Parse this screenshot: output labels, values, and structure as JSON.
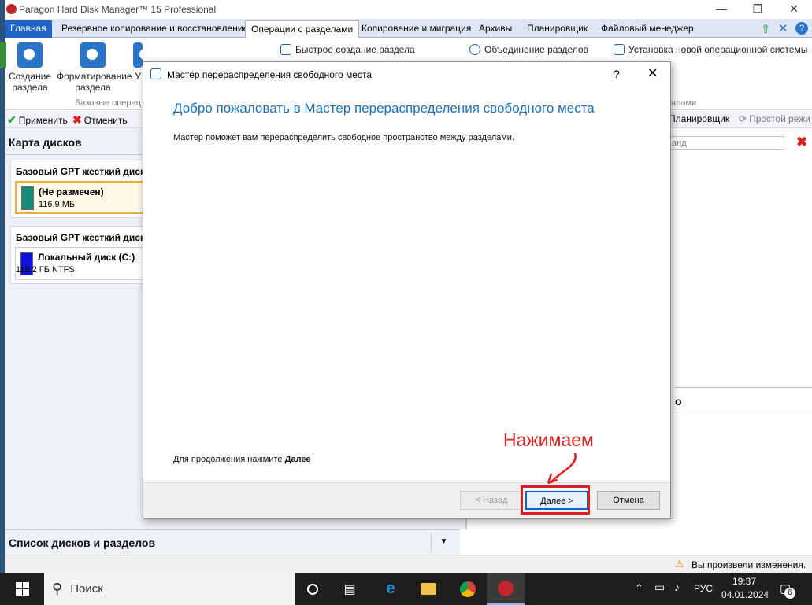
{
  "app": {
    "title": "Paragon Hard Disk Manager™ 15 Professional"
  },
  "menu": {
    "tabs": [
      "Главная",
      "Резервное копирование и восстановление",
      "Операции с разделами",
      "Копирование и миграция",
      "Архивы",
      "Планировщик",
      "Файловый менеджер"
    ]
  },
  "ribbon": {
    "big": [
      "Создание раздела",
      "Форматирование раздела",
      "У",
      "",
      ""
    ],
    "group_basic": "Базовые операц",
    "group_right": "ялами",
    "quick_create": "Быстрое создание раздела",
    "merge": "Объединение разделов",
    "install_os": "Установка новой операционной системы"
  },
  "toolbar": {
    "apply": "Применить",
    "cancel": "Отменить",
    "scheduler": "Планировщик",
    "preview": "Простой режи",
    "search_placeholder": "анд"
  },
  "left": {
    "disk_map": "Карта дисков",
    "disk1": {
      "title": "Базовый GPT жесткий диск",
      "part_name": "(Не размечен)",
      "part_size": "116.9 МБ"
    },
    "disk2": {
      "title": "Базовый GPT жесткий диск",
      "part_name": "Локальный диск (C:)",
      "part_size": "119.2 ГБ NTFS"
    },
    "list_title": "Список дисков и разделов"
  },
  "right": {
    "frag": "о"
  },
  "status": {
    "changes": "Вы произвели изменения."
  },
  "dialog": {
    "title": "Мастер перераспределения свободного места",
    "help": "?",
    "heading": "Добро пожаловать в Мастер перераспределения свободного места",
    "body": "Мастер поможет вам перераспределить свободное пространство между разделами.",
    "hint_prefix": "Для продолжения нажмите ",
    "hint_bold": "Далее",
    "back": "< Назад",
    "next": "Далее >",
    "cancel": "Отмена"
  },
  "annotation": {
    "text": "Нажимаем"
  },
  "taskbar": {
    "search": "Поиск",
    "lang": "РУС",
    "time": "19:37",
    "date": "04.01.2024",
    "notif": "6"
  },
  "colors": {
    "accent": "#1f63c6",
    "heading": "#1d6fb8",
    "annotation": "#e02020",
    "unallocated": "#1a8a7a",
    "system": "#1010e0"
  }
}
